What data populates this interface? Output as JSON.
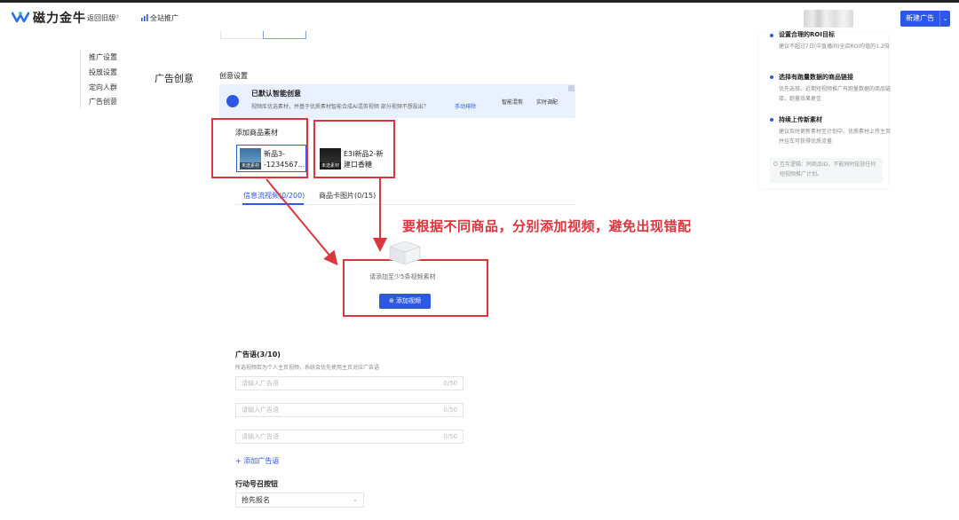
{
  "header": {
    "logo_text": "磁力金牛",
    "back_old": "返回旧版",
    "back_old_icon": "⇄",
    "quanzhan": "全站推广",
    "new_ad_button": "新建广告",
    "new_ad_dropdown": "⌄"
  },
  "sidebar": {
    "items": [
      {
        "label": "推广设置"
      },
      {
        "label": "投放设置"
      },
      {
        "label": "定向人群"
      },
      {
        "label": "广告创意"
      }
    ]
  },
  "main": {
    "section_title": "广告创意",
    "creative_settings": "创意设置",
    "smart": {
      "title": "已默认智能创意",
      "desc": "视频库优选素材，并基于优质素材智能合成AI混剪视频    部分视频不想投出？",
      "link": "手动排除",
      "btn1": "智能混剪",
      "btn2": "实时调配"
    },
    "add_material_label": "添加商品素材",
    "cards": [
      {
        "name": "新品3--1234567...",
        "thumb_label": "未选素材"
      },
      {
        "name": "E3I新品2-新建口香糖",
        "thumb_label": "未选素材"
      }
    ],
    "annotation": "要根据不同商品，分别添加视频，避免出现错配",
    "video_tabs": [
      {
        "label": "信息流视频(0/200)"
      },
      {
        "label": "商品卡图片(0/15)"
      }
    ],
    "empty_text": "请添加至少5条视频素材",
    "add_video_button": "⊕ 添加视频",
    "ad_copy": {
      "label": "广告语(3/10)",
      "desc": "所选视频若为个人主页视频，系统会优先使用主页对应广告语",
      "inputs": [
        {
          "placeholder": "请输入广告语",
          "count": "0/50"
        },
        {
          "placeholder": "请输入广告语",
          "count": "0/50"
        },
        {
          "placeholder": "请输入广告语",
          "count": "0/50"
        }
      ],
      "add_label": "+ 添加广告语"
    },
    "cta": {
      "label": "行动号召按钮",
      "selected": "抢先报名",
      "chevron": "⌄"
    }
  },
  "right_panel": {
    "top_desc_1": "设置合理的ROI目标",
    "top_desc_2": "建议不超过7日(中直播间)全店ROI均值的1.2倍",
    "tips": [
      {
        "title": "选择有跑量数据的商品链接",
        "desc": "优先选择、近期短视频推广有跑量数据的商品链接，跑量效果更佳"
      },
      {
        "title": "持续上传新素材",
        "desc": "建议及时更新素材至计划中，优质素材上传主页并挂车可获得优质流量"
      }
    ],
    "note": "互斥逻辑：同商品ID，不能同时投放任何短视频推广计划。"
  },
  "colors": {
    "accent": "#2c58e3",
    "annotation_red": "#d9363e"
  }
}
